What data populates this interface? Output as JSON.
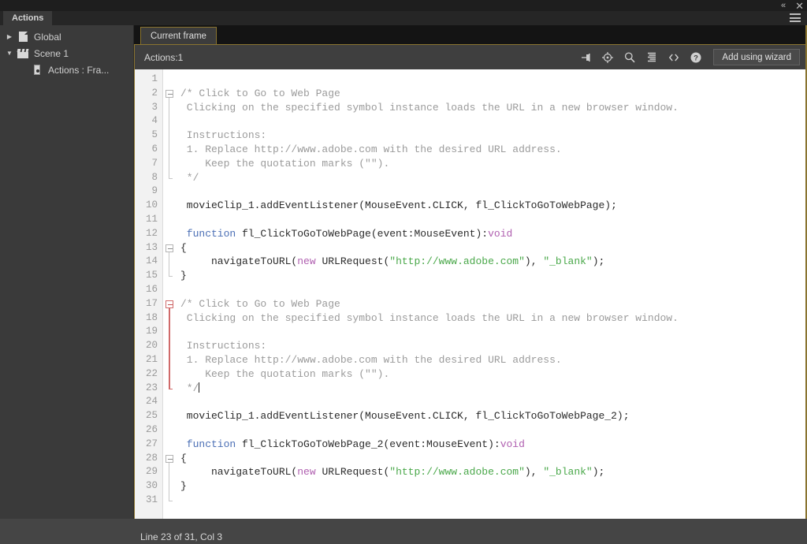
{
  "window": {
    "collapse_icon": "«",
    "close_icon": "✕",
    "menu_icon": "hamburger-menu"
  },
  "panel": {
    "tab_label": "Actions"
  },
  "tree": {
    "items": [
      {
        "label": "Global",
        "twisty": "▶",
        "icon": "document-icon",
        "indent": 0
      },
      {
        "label": "Scene 1",
        "twisty": "▼",
        "icon": "clapperboard-icon",
        "indent": 0
      },
      {
        "label": "Actions : Fra...",
        "twisty": "",
        "icon": "frame-icon",
        "indent": 1
      }
    ]
  },
  "editor": {
    "frame_tab": "Current frame",
    "actions_label": "Actions:1",
    "toolbar_icons": [
      "pin-icon",
      "target-icon",
      "find-icon",
      "format-code-icon",
      "script-assist-icon",
      "help-icon"
    ],
    "wizard_button": "Add using wizard",
    "scroll_left_icon": "‹",
    "scroll_right_icon": "›"
  },
  "status": {
    "text": "Line 23 of 31, Col 3"
  },
  "code": {
    "total_lines": 31,
    "lines": [
      {
        "n": 1,
        "tokens": []
      },
      {
        "n": 2,
        "fold": "start",
        "tokens": [
          {
            "t": "cmt",
            "v": "/* Click to Go to Web Page"
          }
        ]
      },
      {
        "n": 3,
        "tokens": [
          {
            "t": "cmt",
            "v": " Clicking on the specified symbol instance loads the URL in a new browser window."
          }
        ]
      },
      {
        "n": 4,
        "tokens": []
      },
      {
        "n": 5,
        "tokens": [
          {
            "t": "cmt",
            "v": " Instructions:"
          }
        ]
      },
      {
        "n": 6,
        "tokens": [
          {
            "t": "cmt",
            "v": " 1. Replace http://www.adobe.com with the desired URL address."
          }
        ]
      },
      {
        "n": 7,
        "tokens": [
          {
            "t": "cmt",
            "v": "    Keep the quotation marks (\"\")."
          }
        ]
      },
      {
        "n": 8,
        "fold": "end",
        "tokens": [
          {
            "t": "cmt",
            "v": " */"
          }
        ]
      },
      {
        "n": 9,
        "tokens": []
      },
      {
        "n": 10,
        "tokens": [
          {
            "t": "def",
            "v": " movieClip_1.addEventListener(MouseEvent.CLICK, fl_ClickToGoToWebPage);"
          }
        ]
      },
      {
        "n": 11,
        "tokens": []
      },
      {
        "n": 12,
        "tokens": [
          {
            "t": "kw",
            "v": " function"
          },
          {
            "t": "def",
            "v": " fl_ClickToGoToWebPage(event:MouseEvent)"
          },
          {
            "t": "def",
            "v": ":"
          },
          {
            "t": "ty",
            "v": "void"
          }
        ]
      },
      {
        "n": 13,
        "fold": "start",
        "tokens": [
          {
            "t": "def",
            "v": "{"
          }
        ]
      },
      {
        "n": 14,
        "tokens": [
          {
            "t": "def",
            "v": "     navigateToURL("
          },
          {
            "t": "ty",
            "v": "new"
          },
          {
            "t": "def",
            "v": " URLRequest("
          },
          {
            "t": "str",
            "v": "\"http://www.adobe.com\""
          },
          {
            "t": "def",
            "v": "), "
          },
          {
            "t": "str",
            "v": "\"_blank\""
          },
          {
            "t": "def",
            "v": ");"
          }
        ]
      },
      {
        "n": 15,
        "fold": "end",
        "tokens": [
          {
            "t": "def",
            "v": "}"
          }
        ]
      },
      {
        "n": 16,
        "tokens": []
      },
      {
        "n": 17,
        "fold": "start-active",
        "tokens": [
          {
            "t": "cmt",
            "v": "/* Click to Go to Web Page"
          }
        ]
      },
      {
        "n": 18,
        "tokens": [
          {
            "t": "cmt",
            "v": " Clicking on the specified symbol instance loads the URL in a new browser window."
          }
        ]
      },
      {
        "n": 19,
        "tokens": []
      },
      {
        "n": 20,
        "tokens": [
          {
            "t": "cmt",
            "v": " Instructions:"
          }
        ]
      },
      {
        "n": 21,
        "tokens": [
          {
            "t": "cmt",
            "v": " 1. Replace http://www.adobe.com with the desired URL address."
          }
        ]
      },
      {
        "n": 22,
        "tokens": [
          {
            "t": "cmt",
            "v": "    Keep the quotation marks (\"\")."
          }
        ]
      },
      {
        "n": 23,
        "fold": "end-active",
        "caret": true,
        "tokens": [
          {
            "t": "cmt",
            "v": " */"
          }
        ]
      },
      {
        "n": 24,
        "tokens": []
      },
      {
        "n": 25,
        "tokens": [
          {
            "t": "def",
            "v": " movieClip_1.addEventListener(MouseEvent.CLICK, fl_ClickToGoToWebPage_2);"
          }
        ]
      },
      {
        "n": 26,
        "tokens": []
      },
      {
        "n": 27,
        "tokens": [
          {
            "t": "kw",
            "v": " function"
          },
          {
            "t": "def",
            "v": " fl_ClickToGoToWebPage_2(event:MouseEvent)"
          },
          {
            "t": "def",
            "v": ":"
          },
          {
            "t": "ty",
            "v": "void"
          }
        ]
      },
      {
        "n": 28,
        "fold": "start",
        "tokens": [
          {
            "t": "def",
            "v": "{"
          }
        ]
      },
      {
        "n": 29,
        "tokens": [
          {
            "t": "def",
            "v": "     navigateToURL("
          },
          {
            "t": "ty",
            "v": "new"
          },
          {
            "t": "def",
            "v": " URLRequest("
          },
          {
            "t": "str",
            "v": "\"http://www.adobe.com\""
          },
          {
            "t": "def",
            "v": "), "
          },
          {
            "t": "str",
            "v": "\"_blank\""
          },
          {
            "t": "def",
            "v": ");"
          }
        ]
      },
      {
        "n": 30,
        "fold": "end",
        "tokens": [
          {
            "t": "def",
            "v": "}"
          }
        ]
      },
      {
        "n": 31,
        "fold": "tail",
        "tokens": []
      }
    ]
  },
  "colors": {
    "accent_gold": "#8a7430",
    "comment": "#9b9b9b",
    "keyword": "#4b6fb5",
    "type": "#b060b0",
    "string": "#4aa84a",
    "code": "#2b2b2b",
    "fold_active": "#d06a6a"
  }
}
